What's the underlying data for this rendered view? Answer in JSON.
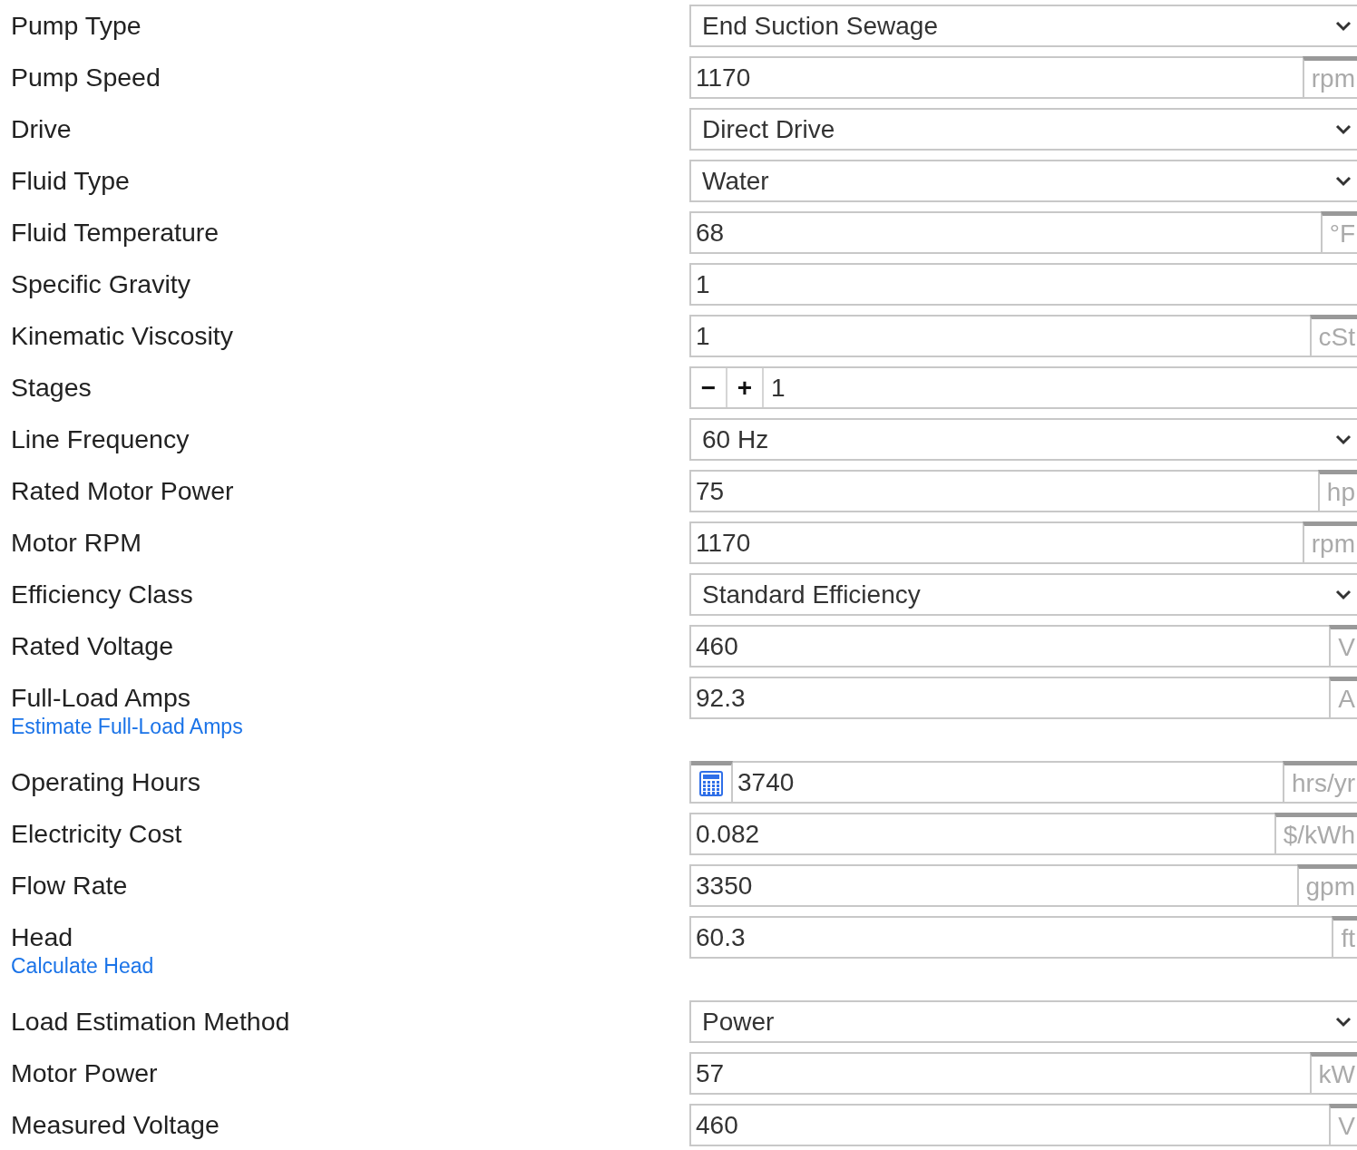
{
  "fields": [
    {
      "label": "Pump Type",
      "kind": "select",
      "value": "End Suction Sewage"
    },
    {
      "label": "Pump Speed",
      "kind": "input",
      "value": "1170",
      "unit": "rpm"
    },
    {
      "label": "Drive",
      "kind": "select",
      "value": "Direct Drive"
    },
    {
      "label": "Fluid Type",
      "kind": "select",
      "value": "Water"
    },
    {
      "label": "Fluid Temperature",
      "kind": "input",
      "value": "68",
      "unit": "°F"
    },
    {
      "label": "Specific Gravity",
      "kind": "input",
      "value": "1"
    },
    {
      "label": "Kinematic Viscosity",
      "kind": "input",
      "value": "1",
      "unit": "cSt"
    },
    {
      "label": "Stages",
      "kind": "stepper",
      "value": "1",
      "decrement": "−",
      "increment": "+"
    },
    {
      "label": "Line Frequency",
      "kind": "select",
      "value": "60 Hz"
    },
    {
      "label": "Rated Motor Power",
      "kind": "input",
      "value": "75",
      "unit": "hp"
    },
    {
      "label": "Motor RPM",
      "kind": "input",
      "value": "1170",
      "unit": "rpm"
    },
    {
      "label": "Efficiency Class",
      "kind": "select",
      "value": "Standard Efficiency"
    },
    {
      "label": "Rated Voltage",
      "kind": "input",
      "value": "460",
      "unit": "V"
    },
    {
      "label": "Full-Load Amps",
      "kind": "input",
      "value": "92.3",
      "unit": "A",
      "link": "Estimate Full-Load Amps"
    },
    {
      "label": "Operating Hours",
      "kind": "calculator",
      "value": "3740",
      "unit": "hrs/yr"
    },
    {
      "label": "Electricity Cost",
      "kind": "input",
      "value": "0.082",
      "unit": "$/kWh"
    },
    {
      "label": "Flow Rate",
      "kind": "input",
      "value": "3350",
      "unit": "gpm"
    },
    {
      "label": "Head",
      "kind": "input",
      "value": "60.3",
      "unit": "ft",
      "link": "Calculate Head"
    },
    {
      "label": "Load Estimation Method",
      "kind": "select",
      "value": "Power"
    },
    {
      "label": "Motor Power",
      "kind": "input",
      "value": "57",
      "unit": "kW"
    },
    {
      "label": "Measured Voltage",
      "kind": "input",
      "value": "460",
      "unit": "V"
    }
  ]
}
